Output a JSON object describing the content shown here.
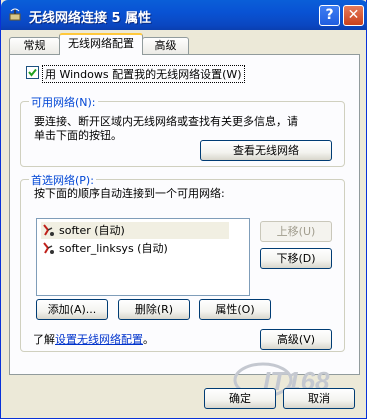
{
  "window": {
    "title": "无线网络连接 5 属性"
  },
  "titlebar": {
    "help_label": "?",
    "close_label": "✕"
  },
  "tabs": [
    {
      "label": "常规"
    },
    {
      "label": "无线网络配置"
    },
    {
      "label": "高级"
    }
  ],
  "checkbox": {
    "label": "用 Windows 配置我的无线网络设置(W)",
    "checked": true
  },
  "available": {
    "legend": "可用网络(N):",
    "description_line1": "要连接、断开区域内无线网络或查找有关更多信息，请",
    "description_line2": "单击下面的按钮。",
    "view_button": "查看无线网络"
  },
  "preferred": {
    "legend": "首选网络(P):",
    "description": "按下面的顺序自动连接到一个可用网络:",
    "items": [
      {
        "label": "softer (自动)"
      },
      {
        "label": "softer_linksys (自动)"
      }
    ],
    "up_button": "上移(U)",
    "down_button": "下移(D)",
    "add_button": "添加(A)...",
    "remove_button": "删除(R)",
    "properties_button": "属性(O)"
  },
  "learn": {
    "prefix": "了解",
    "link": "设置无线网络配置",
    "suffix": "。"
  },
  "advanced_button": "高级(V)",
  "footer": {
    "ok_button": "确定",
    "cancel_button": "取消"
  },
  "colors": {
    "title_blue": "#0a5fd8",
    "link_blue": "#0033cc",
    "legend_blue": "#0046d5"
  }
}
